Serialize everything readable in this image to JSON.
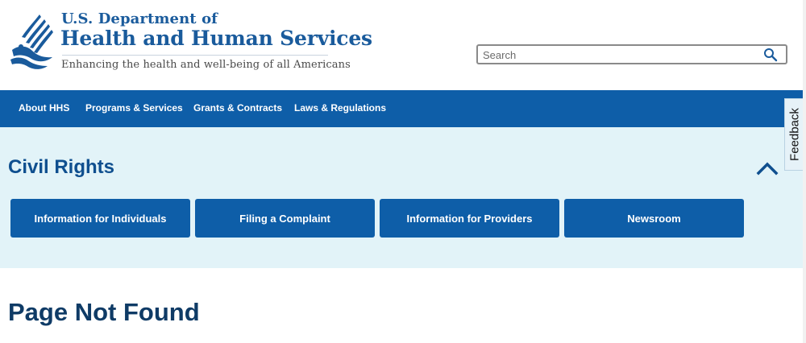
{
  "header": {
    "dept_line": "U.S. Department of",
    "agency_name": "Health and Human Services",
    "tagline": "Enhancing the health and well-being of all Americans",
    "search": {
      "placeholder": "Search",
      "value": ""
    }
  },
  "nav": {
    "items": [
      {
        "label": "About HHS"
      },
      {
        "label": "Programs & Services"
      },
      {
        "label": "Grants & Contracts"
      },
      {
        "label": "Laws & Regulations"
      }
    ]
  },
  "feedback": {
    "label": "Feedback"
  },
  "section": {
    "title": "Civil Rights",
    "tiles": [
      {
        "label": "Information for Individuals"
      },
      {
        "label": "Filing a Complaint"
      },
      {
        "label": "Information for Providers"
      },
      {
        "label": "Newsroom"
      }
    ]
  },
  "main": {
    "title": "Page Not Found"
  },
  "colors": {
    "brand_blue": "#0e5ea8",
    "title_blue": "#0f4f8f",
    "band_bg": "#e2f3f8"
  },
  "icons": [
    "hhs-eagle-logo",
    "search-icon",
    "chevron-up-icon"
  ]
}
